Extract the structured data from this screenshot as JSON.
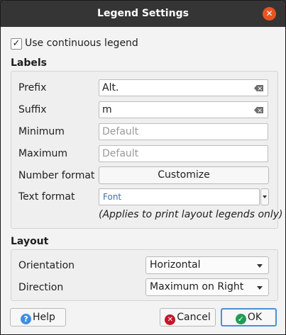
{
  "window": {
    "title": "Legend Settings",
    "close_glyph": "✕"
  },
  "use_continuous": {
    "label": "Use continuous legend",
    "checked": true,
    "check_glyph": "✓"
  },
  "labels": {
    "title": "Labels",
    "prefix": {
      "label": "Prefix",
      "value": "Alt."
    },
    "suffix": {
      "label": "Suffix",
      "value": "m"
    },
    "minimum": {
      "label": "Minimum",
      "placeholder": "Default"
    },
    "maximum": {
      "label": "Maximum",
      "placeholder": "Default"
    },
    "number_format": {
      "label": "Number format",
      "button": "Customize"
    },
    "text_format": {
      "label": "Text format",
      "value": "Font"
    },
    "note": "(Applies to print layout legends only)"
  },
  "layout": {
    "title": "Layout",
    "orientation": {
      "label": "Orientation",
      "value": "Horizontal"
    },
    "direction": {
      "label": "Direction",
      "value": "Maximum on Right"
    }
  },
  "buttons": {
    "help": "Help",
    "help_icon": "?",
    "cancel": "Cancel",
    "cancel_icon": "✕",
    "ok": "OK",
    "ok_icon": "✓"
  },
  "colors": {
    "accent": "#e95420",
    "titlebar": "#353535",
    "help_icon": "#3f8ee0",
    "cancel_icon": "#c7162b",
    "ok_icon": "#1f9d55",
    "ok_border": "#4a90d9"
  }
}
